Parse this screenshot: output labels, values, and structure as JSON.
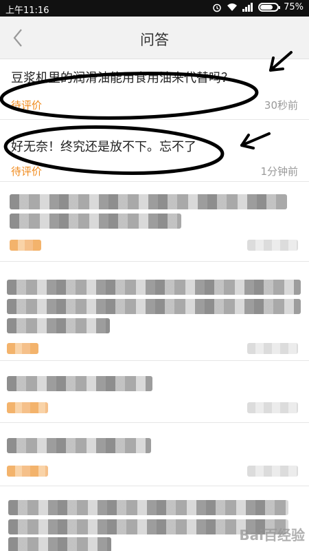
{
  "status_bar": {
    "time": "上午11:16",
    "battery": "75%",
    "battery_level": 0.75
  },
  "header": {
    "title": "问答"
  },
  "questions": [
    {
      "text": "豆浆机里的润滑油能用食用油来代替吗？",
      "status": "待评价",
      "time": "30秒前"
    },
    {
      "text": "好无奈！终究还是放不下。忘不了",
      "status": "待评价",
      "time": "1分钟前"
    }
  ],
  "watermark": "Bai百经验"
}
